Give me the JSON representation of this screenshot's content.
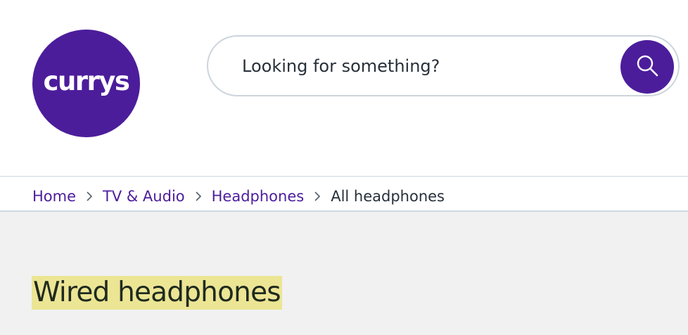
{
  "colors": {
    "brand": "#4c1d9b",
    "title_highlight": "#ece594",
    "text_dark": "#27303a",
    "main_bg": "#f1f1f2",
    "border": "#cfd8e0"
  },
  "header": {
    "logo_text": "currys",
    "search": {
      "placeholder": "Looking for something?",
      "value": "",
      "button_icon": "search-icon"
    }
  },
  "breadcrumb": {
    "separator_icon": "chevron-right-icon",
    "items": [
      {
        "label": "Home",
        "link": true
      },
      {
        "label": "TV & Audio",
        "link": true
      },
      {
        "label": "Headphones",
        "link": true
      },
      {
        "label": "All headphones",
        "link": false
      }
    ]
  },
  "main": {
    "title": "Wired headphones"
  }
}
